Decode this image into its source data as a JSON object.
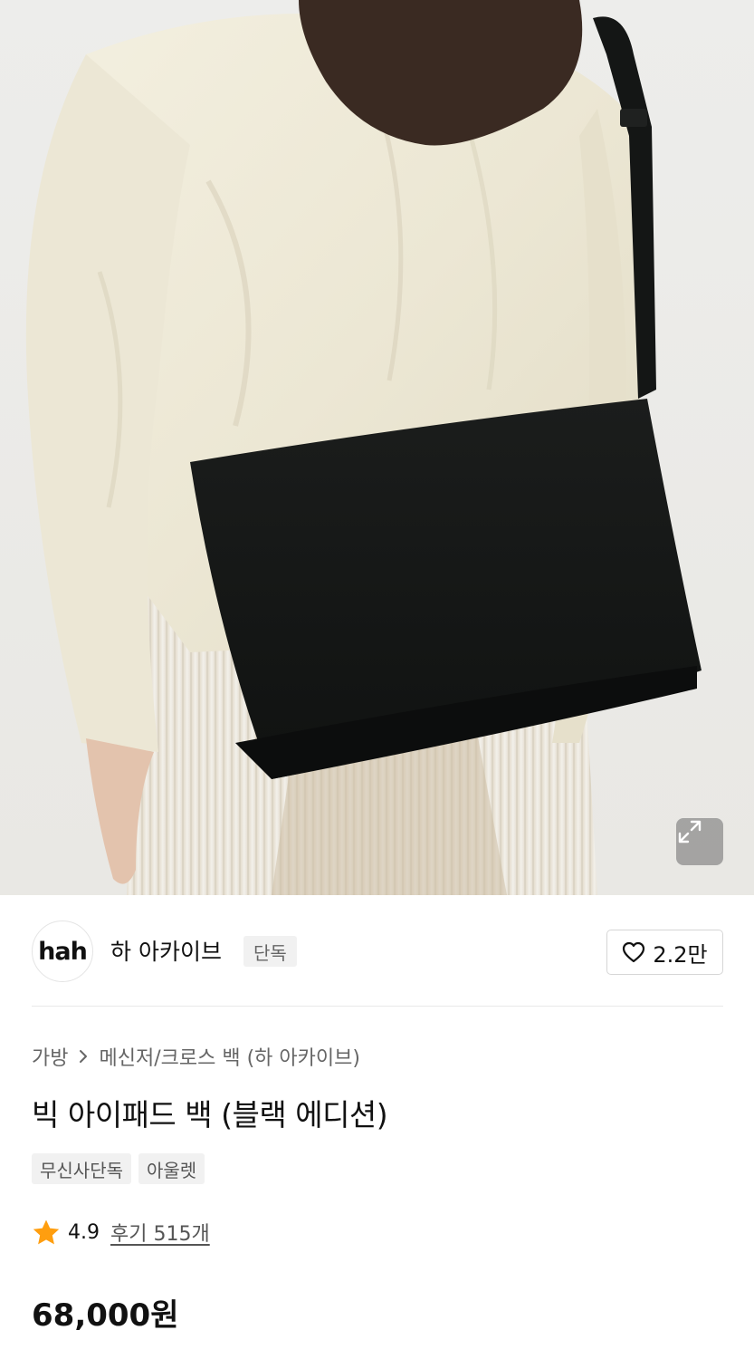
{
  "product_image": {
    "alt": ""
  },
  "brand": {
    "logo_text": "hah",
    "name": "하 아카이브",
    "badge": "단독"
  },
  "like": {
    "count": "2.2만"
  },
  "breadcrumb": {
    "category": "가방",
    "separator": ">",
    "subcategory": "메신저/크로스 백 (하 아카이브)"
  },
  "product": {
    "title": "빅 아이패드 백 (블랙 에디션)",
    "tags": [
      "무신사단독",
      "아울렛"
    ],
    "rating": "4.9",
    "reviews_label": "후기 515개",
    "price": "68,000원"
  },
  "colors": {
    "star": "#ff9e0f",
    "text": "#111111",
    "muted": "#666666"
  }
}
